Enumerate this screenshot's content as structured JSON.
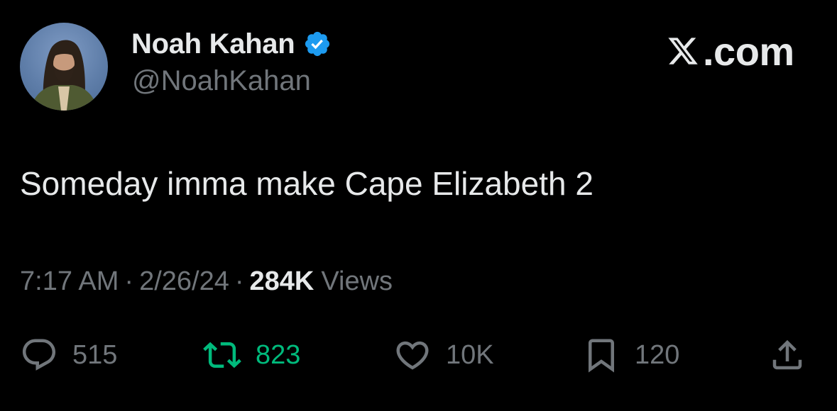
{
  "author": {
    "display_name": "Noah Kahan",
    "handle": "@NoahKahan",
    "verified": true
  },
  "brand": {
    "text": ".com",
    "icon": "x-logo-icon"
  },
  "tweet": {
    "text": "Someday imma make Cape Elizabeth 2",
    "time": "7:17 AM",
    "separator": "·",
    "date": "2/26/24",
    "views_count": "284K",
    "views_label": "Views"
  },
  "actions": {
    "replies": "515",
    "reposts": "823",
    "likes": "10K",
    "bookmarks": "120"
  },
  "colors": {
    "background": "#000000",
    "text_primary": "#e7e9ea",
    "text_secondary": "#71767b",
    "verified_badge": "#1d9bf0",
    "repost_active": "#00ba7c"
  },
  "icons": {
    "reply": "reply-bubble-icon",
    "repost": "repost-arrows-icon",
    "like": "heart-icon",
    "bookmark": "bookmark-icon",
    "share": "share-icon",
    "verified": "verified-badge-icon"
  }
}
